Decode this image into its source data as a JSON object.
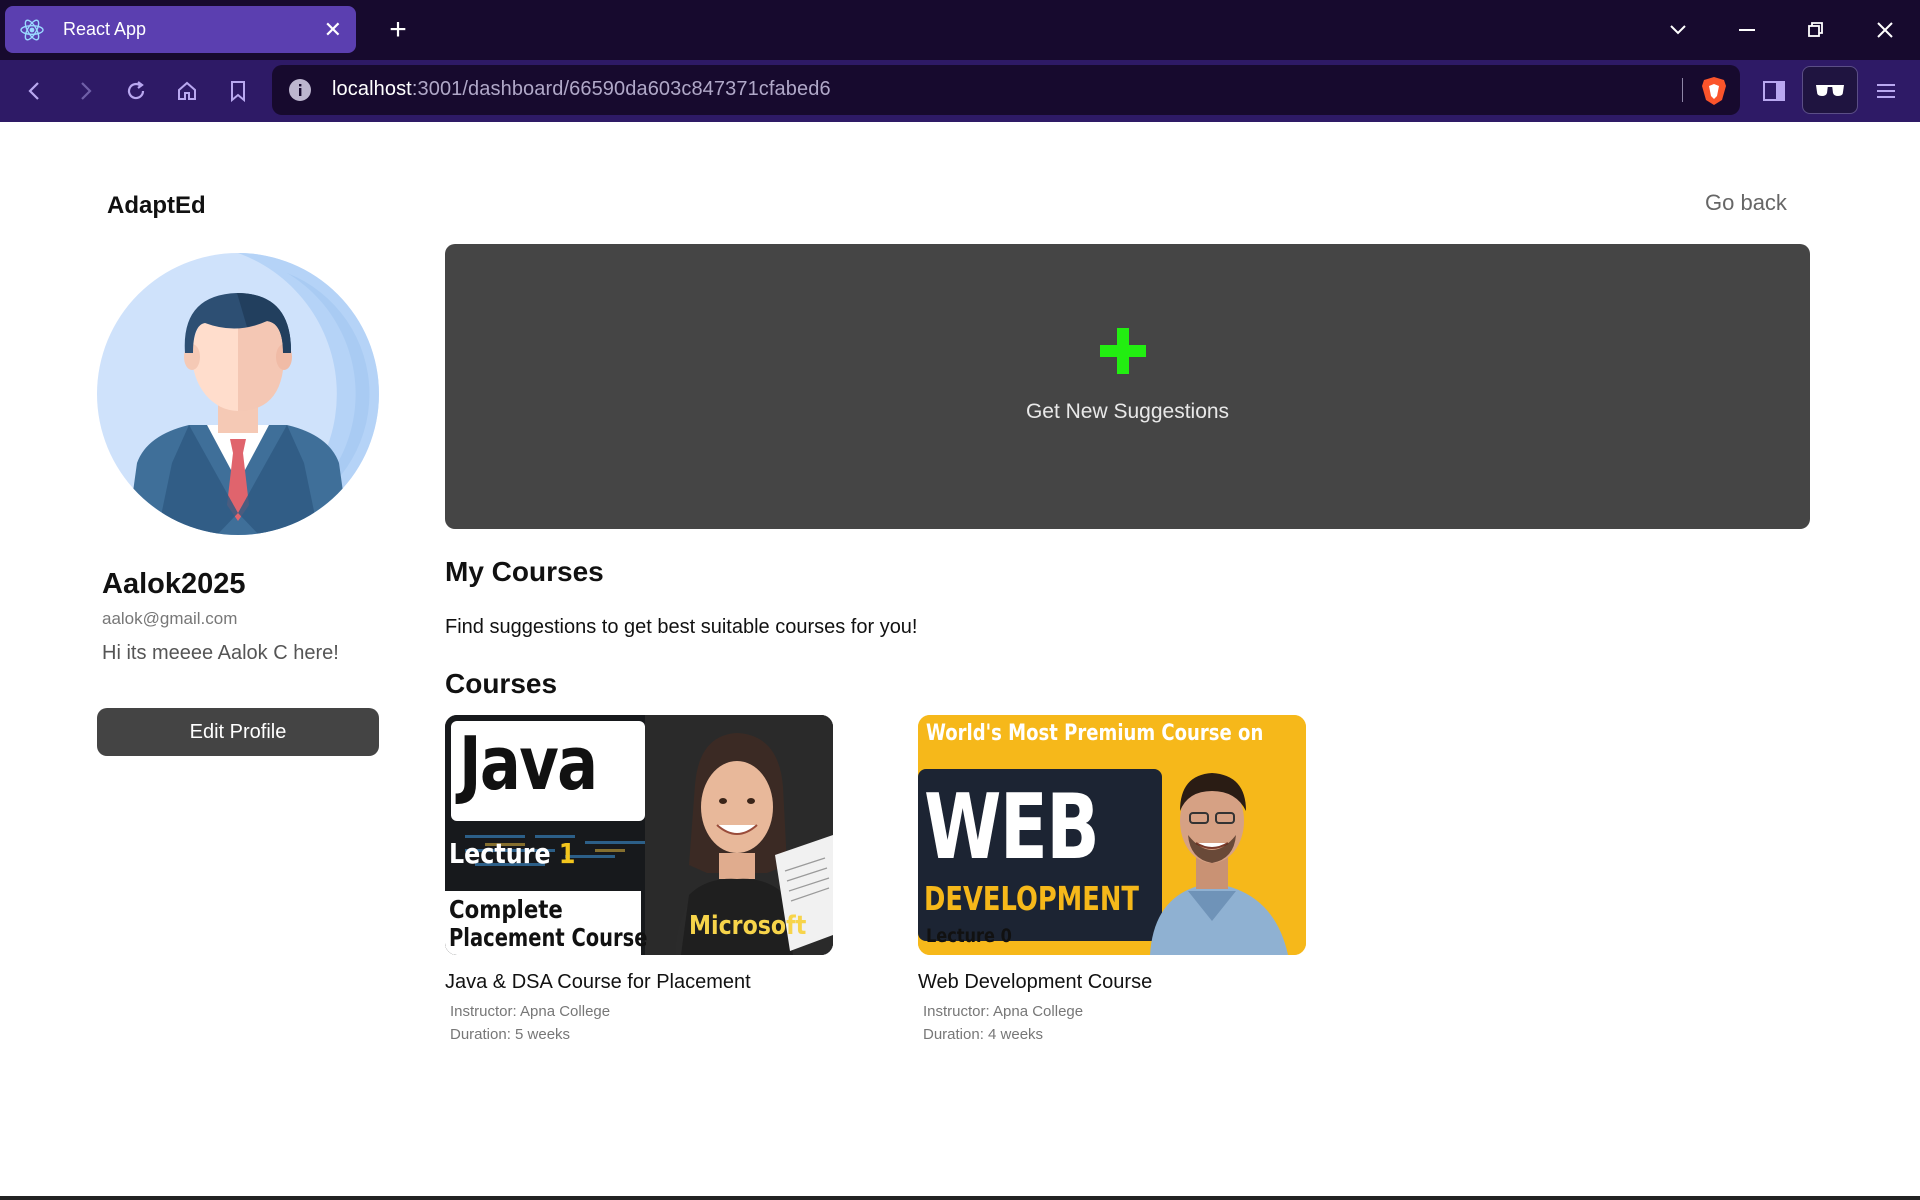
{
  "browser": {
    "tab_title": "React App",
    "url_host": "localhost",
    "url_rest": ":3001/dashboard/66590da603c847371cfabed6"
  },
  "app": {
    "brand": "AdaptEd",
    "go_back": "Go back"
  },
  "profile": {
    "username": "Aalok2025",
    "email": "aalok@gmail.com",
    "bio": "Hi its meeee Aalok C here!",
    "edit_label": "Edit Profile"
  },
  "suggestions": {
    "label": "Get New Suggestions",
    "plus_color": "#22ee11",
    "card_color": "#454545"
  },
  "my_courses": {
    "heading": "My Courses",
    "hint": "Find suggestions to get best suitable courses for you!"
  },
  "courses": {
    "heading": "Courses",
    "items": [
      {
        "title": "Java & DSA Course for Placement",
        "instructor": "Instructor: Apna College",
        "duration": "Duration: 5 weeks",
        "thumb": {
          "big": "Java",
          "line1": "Lecture",
          "line1_num": "1",
          "line2": "Complete",
          "line3": "Placement Course",
          "tag": "Microsoft"
        }
      },
      {
        "title": "Web Development Course",
        "instructor": "Instructor: Apna College",
        "duration": "Duration: 4 weeks",
        "thumb": {
          "banner": "World's Most Premium Course on",
          "big": "WEB",
          "sub": "DEVELOPMENT",
          "lecture": "Lecture 0"
        }
      }
    ]
  }
}
